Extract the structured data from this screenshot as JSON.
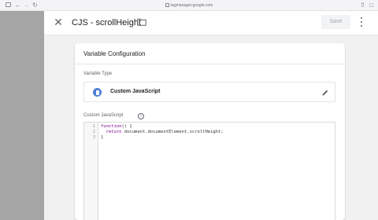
{
  "browser": {
    "url": "tagmanager.google.com"
  },
  "header": {
    "title": "CJS - scrollHeight",
    "save_label": "Save"
  },
  "card": {
    "title": "Variable Configuration",
    "variable_type_label": "Variable Type",
    "variable_type_name": "Custom JavaScript",
    "custom_js_label": "Custom JavaScript"
  },
  "code": {
    "line_numbers": [
      "1",
      "2",
      "3"
    ],
    "line1_keyword": "function",
    "line1_rest": "() {",
    "line2_indent": "  ",
    "line2_keyword": "return",
    "line2_rest": " document.documentElement.scrollHeight;",
    "line3": "}"
  },
  "colors": {
    "accent_icon": "#4a7fd8",
    "keyword": "#770088",
    "sidebar_gray": "#a5a5a5"
  }
}
